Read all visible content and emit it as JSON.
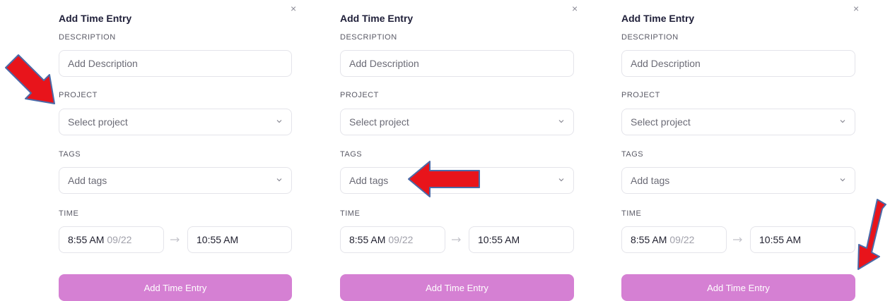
{
  "panels": [
    {
      "close_label": "×",
      "title": "Add Time Entry",
      "description_label": "DESCRIPTION",
      "description_placeholder": "Add Description",
      "project_label": "PROJECT",
      "project_placeholder": "Select project",
      "tags_label": "TAGS",
      "tags_placeholder": "Add tags",
      "time_label": "TIME",
      "start_time": "8:55 AM",
      "start_date": "09/22",
      "end_time": "10:55 AM",
      "submit_label": "Add Time Entry"
    },
    {
      "close_label": "×",
      "title": "Add Time Entry",
      "description_label": "DESCRIPTION",
      "description_placeholder": "Add Description",
      "project_label": "PROJECT",
      "project_placeholder": "Select project",
      "tags_label": "TAGS",
      "tags_placeholder": "Add tags",
      "time_label": "TIME",
      "start_time": "8:55 AM",
      "start_date": "09/22",
      "end_time": "10:55 AM",
      "submit_label": "Add Time Entry"
    },
    {
      "close_label": "×",
      "title": "Add Time Entry",
      "description_label": "DESCRIPTION",
      "description_placeholder": "Add Description",
      "project_label": "PROJECT",
      "project_placeholder": "Select project",
      "tags_label": "TAGS",
      "tags_placeholder": "Add tags",
      "time_label": "TIME",
      "start_time": "8:55 AM",
      "start_date": "09/22",
      "end_time": "10:55 AM",
      "submit_label": "Add Time Entry"
    }
  ],
  "colors": {
    "submit_button": "#d580d3",
    "annotation_arrow_fill": "#e8141b",
    "annotation_arrow_outline": "#4a6aa8"
  },
  "icons": {
    "close": "close-icon",
    "dropdown": "chevron-down-icon",
    "time_separator": "arrow-right-icon"
  },
  "annotations": [
    {
      "target_panel": 1,
      "points_to": "project-field",
      "direction": "down-right"
    },
    {
      "target_panel": 2,
      "points_to": "tags-field",
      "direction": "left"
    },
    {
      "target_panel": 3,
      "points_to": "submit-button",
      "direction": "down-left"
    }
  ]
}
